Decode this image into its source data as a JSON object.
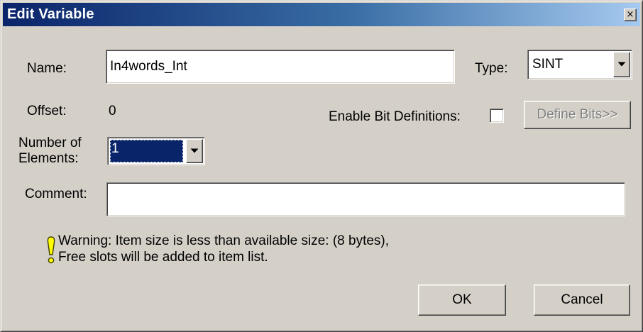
{
  "window": {
    "title": "Edit Variable",
    "close_glyph": "×"
  },
  "form": {
    "name_label": "Name:",
    "name_value": "In4words_Int",
    "type_label": "Type:",
    "type_value": "SINT",
    "offset_label": "Offset:",
    "offset_value": "0",
    "enable_bits_label": "Enable Bit Definitions:",
    "enable_bits_checked": false,
    "define_bits_label": "Define Bits>>",
    "elements_label_line1": "Number of",
    "elements_label_line2": "Elements:",
    "elements_value": "1",
    "comment_label": "Comment:",
    "comment_value": ""
  },
  "warning": {
    "icon": "warning-exclamation-icon",
    "line1": "Warning: Item size is less than available size: (8 bytes),",
    "line2": "Free slots will be added to item list."
  },
  "buttons": {
    "ok_label": "OK",
    "cancel_label": "Cancel"
  },
  "colors": {
    "titlebar_start": "#0a246a",
    "titlebar_end": "#a6caf0",
    "dialog_face": "#d4d0c8",
    "selection": "#0a246a",
    "warning_icon": "#ffff00"
  }
}
